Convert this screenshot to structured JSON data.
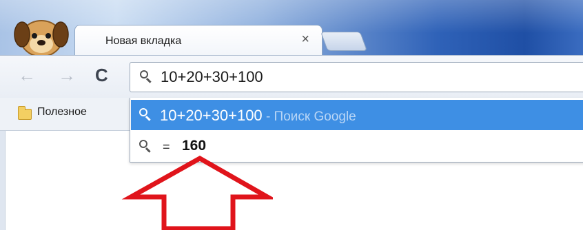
{
  "tab": {
    "title": "Новая вкладка",
    "close_glyph": "×"
  },
  "toolbar": {
    "back_glyph": "←",
    "forward_glyph": "→",
    "reload_glyph": "C"
  },
  "omnibox": {
    "value": "10+20+30+100"
  },
  "bookmarks": {
    "folder_label": "Полезное"
  },
  "suggestions": [
    {
      "query": "10+20+30+100",
      "hint": " - Поиск Google",
      "highlighted": true
    },
    {
      "prefix": "= ",
      "result": "160",
      "highlighted": false
    }
  ],
  "icons": {
    "avatar": "dog-avatar-icon",
    "search": "magnifier-icon",
    "folder": "folder-icon",
    "annotation": "red-outline-up-arrow"
  },
  "colors": {
    "highlight": "#3e8fe4",
    "annotation": "#e0141b"
  }
}
